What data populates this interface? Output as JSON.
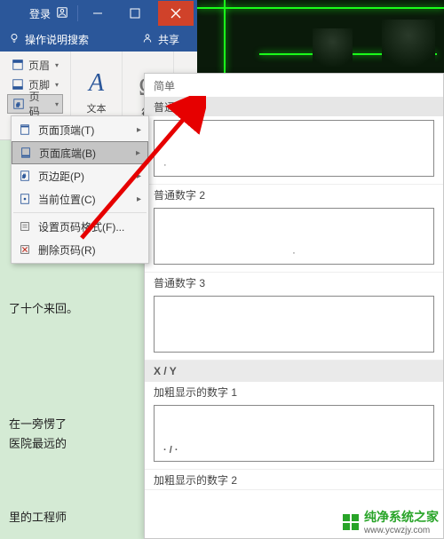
{
  "titlebar": {
    "login": "登录"
  },
  "toolbar": {
    "search_label": "操作说明搜索",
    "share_label": "共享"
  },
  "ribbon": {
    "header_label": "页眉",
    "footer_label": "页脚",
    "pagenum_label": "页码",
    "textbox_label": "文本",
    "symbol_label": "符·"
  },
  "dropdown": {
    "items": [
      {
        "label": "页面顶端(T)",
        "has_arrow": true
      },
      {
        "label": "页面底端(B)",
        "has_arrow": true,
        "highlight": true
      },
      {
        "label": "页边距(P)",
        "has_arrow": true
      },
      {
        "label": "当前位置(C)",
        "has_arrow": true
      },
      {
        "label": "设置页码格式(F)...",
        "has_arrow": false
      },
      {
        "label": "删除页码(R)",
        "has_arrow": false
      }
    ]
  },
  "gallery": {
    "simple_header": "简单",
    "xy_header": "X / Y",
    "items": [
      {
        "label": "普通数字 1",
        "align": "left",
        "content": "·"
      },
      {
        "label": "普通数字 2",
        "align": "center",
        "content": "·"
      },
      {
        "label": "普通数字 3",
        "align": "center",
        "content": ""
      }
    ],
    "xy_items": [
      {
        "label": "加粗显示的数字 1",
        "align": "left",
        "content": "· / ·"
      },
      {
        "label": "加粗显示的数字 2",
        "align": "center",
        "content": ""
      }
    ]
  },
  "doc_text": {
    "t1": "了十个来回。",
    "t2": "在一旁愣了",
    "t3": "医院最远的",
    "t4": "里的工程师"
  },
  "watermark": {
    "brand": "纯净系统之家",
    "url": "www.ycwzjy.com"
  }
}
